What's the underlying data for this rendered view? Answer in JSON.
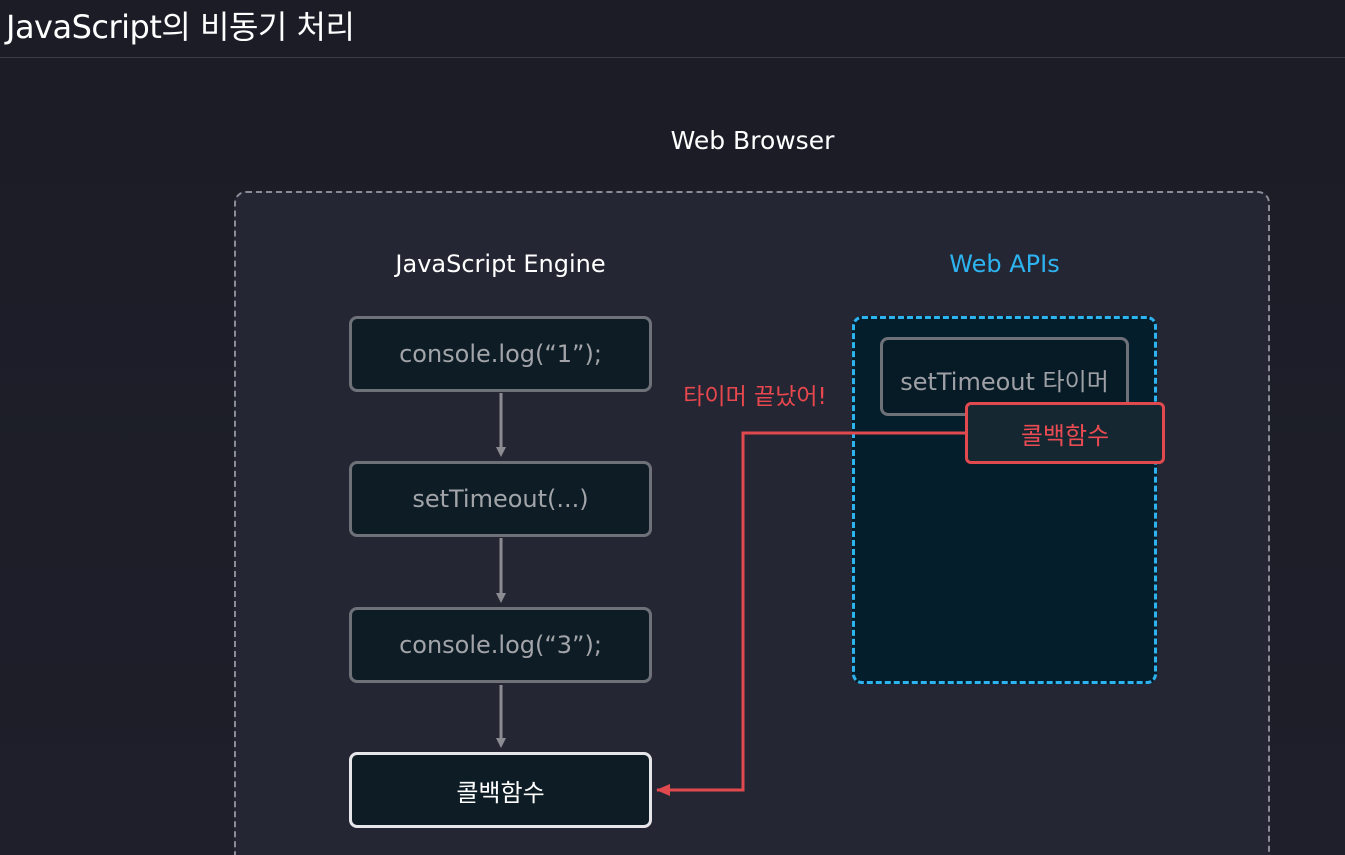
{
  "header": {
    "title": "JavaScript의 비동기 처리"
  },
  "diagram": {
    "browser_label": "Web Browser",
    "engine": {
      "label": "JavaScript Engine",
      "stack": [
        {
          "text": "console.log(“1”);"
        },
        {
          "text": "setTimeout(...)"
        },
        {
          "text": "console.log(“3”);"
        },
        {
          "text": "콜백함수"
        }
      ]
    },
    "web_apis": {
      "label": "Web APIs",
      "timer_text": "setTimeout 타이머",
      "callback_text": "콜백함수"
    },
    "timer_done_text": "타이머 끝났어!"
  },
  "colors": {
    "background": "#1c1d27",
    "panel": "#252633",
    "box_fill": "#0d1c25",
    "box_border": "#6f7178",
    "web_apis_accent": "#2db4f0",
    "callback_accent": "#e04a4f",
    "text_primary": "#ffffff",
    "text_muted": "#a2a4a9"
  }
}
